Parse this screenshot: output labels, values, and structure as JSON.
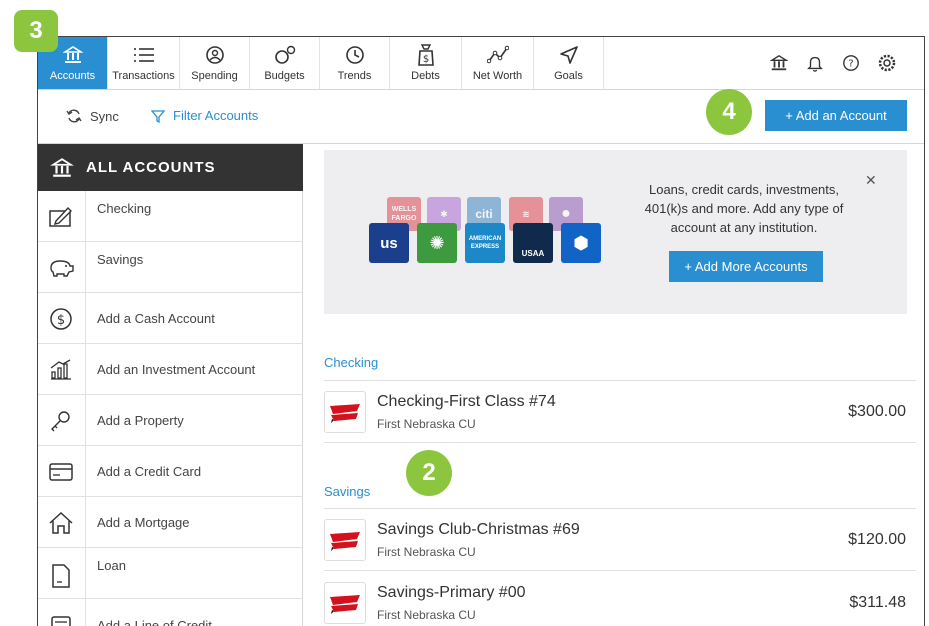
{
  "callouts": {
    "b3": "3",
    "b4": "4",
    "b2": "2"
  },
  "nav": {
    "tabs": [
      {
        "label": "Accounts",
        "icon": "bank-icon"
      },
      {
        "label": "Transactions",
        "icon": "list-icon"
      },
      {
        "label": "Spending",
        "icon": "spending-icon"
      },
      {
        "label": "Budgets",
        "icon": "budgets-icon"
      },
      {
        "label": "Trends",
        "icon": "clock-icon"
      },
      {
        "label": "Debts",
        "icon": "debts-icon"
      },
      {
        "label": "Net Worth",
        "icon": "net-worth-icon"
      },
      {
        "label": "Goals",
        "icon": "goals-icon"
      }
    ],
    "active": "Accounts"
  },
  "toolbar": {
    "sync_label": "Sync",
    "filter_label": "Filter Accounts",
    "add_account_label": "+ Add an Account"
  },
  "sidebar": {
    "header": "ALL ACCOUNTS",
    "items": [
      {
        "label": "Checking",
        "icon": "checking-icon"
      },
      {
        "label": "Savings",
        "icon": "piggy-bank-icon"
      },
      {
        "label": "Add a Cash Account",
        "icon": "dollar-icon"
      },
      {
        "label": "Add an Investment Account",
        "icon": "investment-icon"
      },
      {
        "label": "Add a Property",
        "icon": "key-icon"
      },
      {
        "label": "Add a Credit Card",
        "icon": "credit-card-icon"
      },
      {
        "label": "Add a Mortgage",
        "icon": "house-icon"
      },
      {
        "label": "Loan",
        "icon": "loan-icon"
      },
      {
        "label": "Add a Line of Credit",
        "icon": "line-of-credit-icon"
      }
    ]
  },
  "promo": {
    "text_line1": "Loans, credit cards, investments,",
    "text_line2_a": "401(k)s and more. ",
    "text_line2_b": "Add any type of",
    "text_line3": "account at any institution.",
    "button_label": "+ Add More Accounts",
    "logos": {
      "wells": "WELLS FARGO",
      "citi": "citi",
      "us": "us",
      "amex": "AMERICAN EXPRESS",
      "usaa": "USAA"
    }
  },
  "sections": {
    "checking": {
      "title": "Checking",
      "accounts": [
        {
          "name": "Checking-First Class #74",
          "institution": "First Nebraska CU",
          "balance": "$300.00"
        }
      ]
    },
    "savings": {
      "title": "Savings",
      "accounts": [
        {
          "name": "Savings Club-Christmas #69",
          "institution": "First Nebraska CU",
          "balance": "$120.00"
        },
        {
          "name": "Savings-Primary #00",
          "institution": "First Nebraska CU",
          "balance": "$311.48"
        }
      ]
    }
  },
  "colors": {
    "accent": "#2a8fd0",
    "callout": "#8cc63f",
    "sidebar_header": "#333333"
  }
}
